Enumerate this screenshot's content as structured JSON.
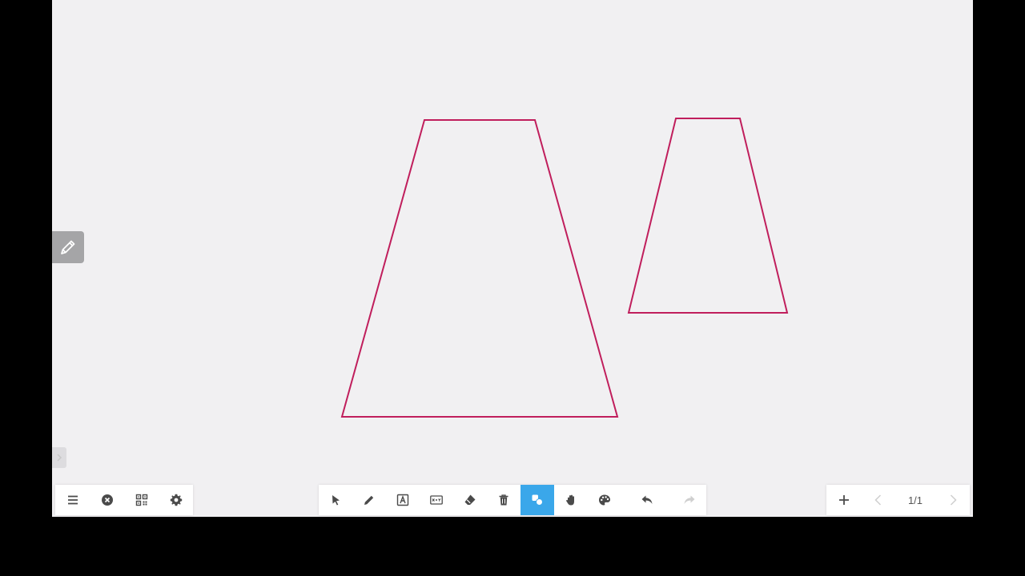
{
  "colors": {
    "board_background": "#f1f0f2",
    "shape_stroke": "#c01e5c",
    "active_tool": "#3aa7ea",
    "icon": "#4a4a4a",
    "icon_disabled": "#cfcfcf"
  },
  "side_panel": {
    "pen_icon": "pencil-icon",
    "expand_icon": "chevron-right-icon"
  },
  "left_toolbar": {
    "items": [
      "menu-icon",
      "close-circle-icon",
      "qr-code-icon",
      "gear-icon"
    ]
  },
  "center_toolbar": {
    "items": [
      "pointer-icon",
      "pencil-icon",
      "text-icon",
      "formula-icon",
      "eraser-icon",
      "trash-icon",
      "shapes-icon",
      "hand-icon",
      "palette-icon",
      "undo-icon",
      "redo-icon"
    ],
    "active_item": "shapes-icon"
  },
  "right_toolbar": {
    "add_icon": "plus-icon",
    "prev_icon": "chevron-left-icon",
    "next_icon": "chevron-right-icon",
    "page_indicator": "1/1"
  }
}
